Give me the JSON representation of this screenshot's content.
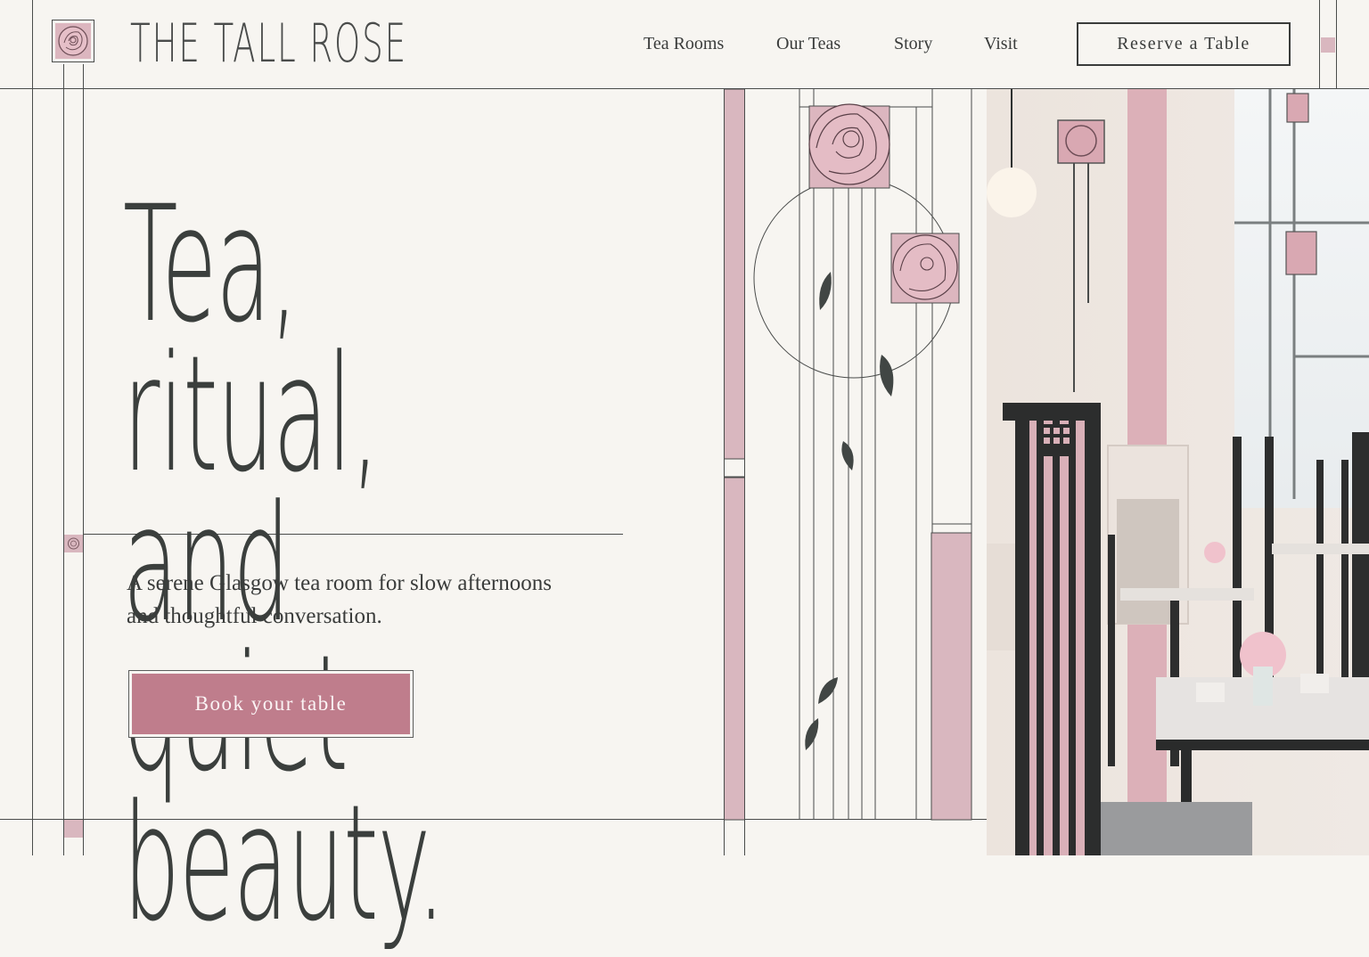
{
  "brand": {
    "name": "THE TALL ROSE",
    "logo_icon": "rose-icon"
  },
  "nav": {
    "items": [
      {
        "label": "Tea Rooms"
      },
      {
        "label": "Our Teas"
      },
      {
        "label": "Story"
      },
      {
        "label": "Visit"
      }
    ],
    "reserve_label": "Reserve a Table"
  },
  "hero": {
    "headline_line1": "Tea, ritual, and",
    "headline_line2": "quiet beauty.",
    "subtitle_line1": "A serene Glasgow tea room for slow afternoons",
    "subtitle_line2": "and thoughtful conversation.",
    "cta_label": "Book your table"
  },
  "colors": {
    "background": "#f7f5f1",
    "ink": "#3a3c3b",
    "rose": "#bf7d8c",
    "rose_light": "#d9b7bf"
  }
}
